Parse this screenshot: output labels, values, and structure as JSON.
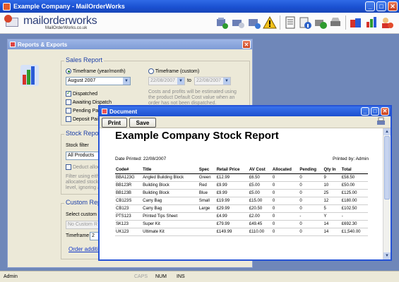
{
  "app": {
    "title": "Example Company - MailOrderWorks",
    "brand": "mailorderworks",
    "brand_url": "MailOrderWorks.co.uk"
  },
  "toolbar_icons": [
    "add-customer-icon",
    "users-icon",
    "refresh-icon",
    "search-icon",
    "warning-icon",
    "notes-icon",
    "info-icon",
    "add-product-icon",
    "ship-icon",
    "bags-icon",
    "stock-icon",
    "close-user-icon"
  ],
  "reports_window": {
    "title": "Reports & Exports",
    "sales": {
      "title": "Sales Report",
      "opt_month": "Timeframe (year/month)",
      "month_value": "August 2007",
      "opt_custom": "Timeframe (custom)",
      "date_from": "22/08/2007",
      "to_label": "to",
      "date_to": "22/08/2007",
      "chk_dispatched": "Dispatched",
      "chk_awaiting": "Awaiting Dispatch",
      "chk_pending": "Pending Paym",
      "chk_deposit": "Deposit Paid",
      "note": "Costs and profits will be estimated using the product Default Cost value when an order has not been dispatched."
    },
    "stock": {
      "title": "Stock Report",
      "filter_label": "Stock filter",
      "filter_value": "All Products",
      "deduct": "Deduct alloca",
      "hint": "Filter using eith allocated stock level, ignoring a"
    },
    "custom": {
      "title": "Custom Repo",
      "select_label": "Select custom rep",
      "select_value": "No Custom R",
      "timeframe_label": "Timeframe",
      "timeframe_value": "2",
      "link": "Order addition"
    }
  },
  "document_window": {
    "title": "Document",
    "print_label": "Print",
    "save_label": "Save",
    "report_title": "Example Company Stock Report",
    "date_printed": "Date Printed: 22/08/2007",
    "printed_by": "Printed by: Admin",
    "columns": [
      "Code#",
      "Title",
      "Spec",
      "Retail Price",
      "AV Cost",
      "Allocated",
      "Pending",
      "Qty In",
      "Total"
    ],
    "rows": [
      [
        "BBA123G",
        "Angled Building Block",
        "Green",
        "£12.99",
        "£6.50",
        "0",
        "0",
        "9",
        "£58.50"
      ],
      [
        "BB123R",
        "Building Block",
        "Red",
        "£9.99",
        "£5.00",
        "0",
        "0",
        "10",
        "£50.00"
      ],
      [
        "BB123B",
        "Building Block",
        "Blue",
        "£9.99",
        "£5.00",
        "0",
        "0",
        "25",
        "£125.00"
      ],
      [
        "CB123S",
        "Carry Bag",
        "Small",
        "£19.99",
        "£15.00",
        "0",
        "0",
        "12",
        "£180.00"
      ],
      [
        "CB123",
        "Carry Bag",
        "Large",
        "£29.99",
        "£20.50",
        "0",
        "0",
        "5",
        "£102.50"
      ],
      [
        "PTS123",
        "Printed Tips Sheet",
        "",
        "£4.99",
        "£2.00",
        "0",
        "-",
        "Y",
        "-"
      ],
      [
        "SK123",
        "Super Kit",
        "",
        "£79.99",
        "£49.45",
        "0",
        "0",
        "14",
        "£692.30"
      ],
      [
        "UK123",
        "Ultimate Kit",
        "",
        "£149.99",
        "£110.00",
        "0",
        "0",
        "14",
        "£1,540.00"
      ]
    ]
  },
  "status": {
    "user": "Admin",
    "caps": "CAPS",
    "num": "NUM",
    "ins": "INS"
  }
}
